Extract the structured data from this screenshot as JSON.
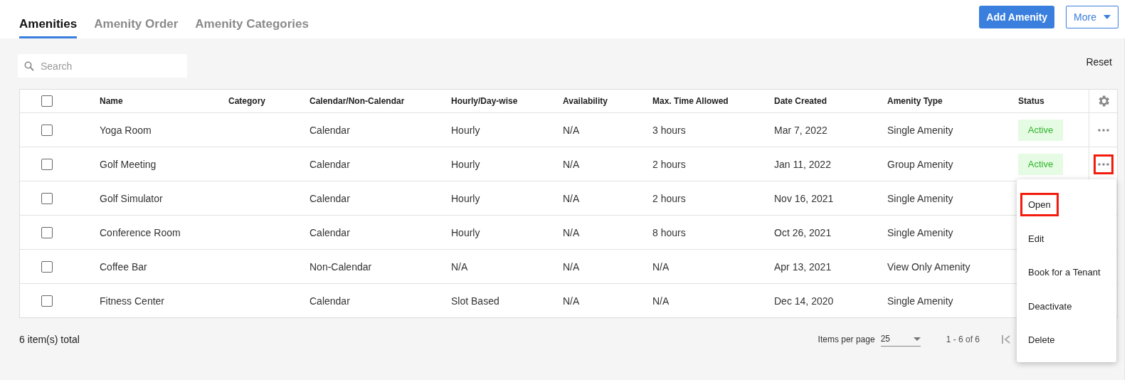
{
  "tabs": [
    {
      "label": "Amenities",
      "selected": true
    },
    {
      "label": "Amenity Order",
      "selected": false
    },
    {
      "label": "Amenity Categories",
      "selected": false
    }
  ],
  "actions": {
    "primary": "Add Amenity",
    "more": "More"
  },
  "search": {
    "placeholder": "Search"
  },
  "reset": "Reset",
  "table": {
    "all_checked": false,
    "columns": [
      "Name",
      "Category",
      "Calendar/Non-Calendar",
      "Hourly/Day-wise",
      "Availability",
      "Max. Time Allowed",
      "Date Created",
      "Amenity Type",
      "Status"
    ],
    "rows": [
      {
        "checked": false,
        "cells": [
          "Yoga Room",
          "",
          "Calendar",
          "Hourly",
          "N/A",
          "3 hours",
          "Mar 7, 2022",
          "Single Amenity"
        ],
        "status": "Active",
        "more_highlighted": false
      },
      {
        "checked": false,
        "cells": [
          "Golf Meeting",
          "",
          "Calendar",
          "Hourly",
          "N/A",
          "2 hours",
          "Jan 11, 2022",
          "Group Amenity"
        ],
        "status": "Active",
        "more_highlighted": true
      },
      {
        "checked": false,
        "cells": [
          "Golf Simulator",
          "",
          "Calendar",
          "Hourly",
          "N/A",
          "2 hours",
          "Nov 16, 2021",
          "Single Amenity"
        ]
      },
      {
        "checked": false,
        "cells": [
          "Conference Room",
          "",
          "Calendar",
          "Hourly",
          "N/A",
          "8 hours",
          "Oct 26, 2021",
          "Single Amenity"
        ]
      },
      {
        "checked": false,
        "cells": [
          "Coffee Bar",
          "",
          "Non-Calendar",
          "N/A",
          "N/A",
          "N/A",
          "Apr 13, 2021",
          "View Only Amenity"
        ]
      },
      {
        "checked": false,
        "cells": [
          "Fitness Center",
          "",
          "Calendar",
          "Slot Based",
          "N/A",
          "N/A",
          "Dec 14, 2020",
          "Single Amenity"
        ]
      }
    ]
  },
  "footer": {
    "total": "6 item(s) total",
    "per_page_label": "Items per page",
    "per_page": "25",
    "range": "1 - 6 of 6"
  },
  "menu": [
    {
      "label": "Open",
      "highlighted": true
    },
    {
      "label": "Edit",
      "highlighted": false
    },
    {
      "label": "Book for a Tenant",
      "highlighted": false
    },
    {
      "label": "Deactivate",
      "highlighted": false
    },
    {
      "label": "Delete",
      "highlighted": false
    }
  ]
}
